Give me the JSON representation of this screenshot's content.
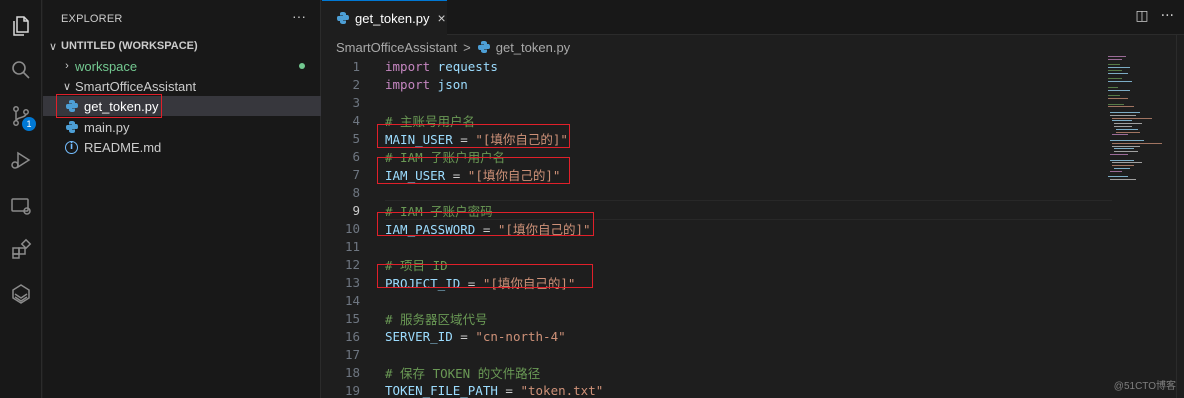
{
  "sidebar": {
    "title": "EXPLORER",
    "more": "···",
    "workspace_title": "UNTITLED (WORKSPACE)",
    "items": [
      {
        "label": "workspace"
      },
      {
        "label": "SmartOfficeAssistant"
      },
      {
        "label": "get_token.py"
      },
      {
        "label": "main.py"
      },
      {
        "label": "README.md"
      }
    ]
  },
  "activity": {
    "source_control_badge": "1"
  },
  "tab": {
    "label": "get_token.py",
    "close": "×"
  },
  "tab_actions": {
    "split": "◫",
    "more": "···"
  },
  "breadcrumb": {
    "folder": "SmartOfficeAssistant",
    "sep": ">",
    "file": "get_token.py"
  },
  "code": {
    "active_line": 9,
    "lines": [
      {
        "n": "1",
        "parts": [
          {
            "t": "import",
            "c": "kw"
          },
          {
            "t": " requests",
            "c": "plain"
          }
        ]
      },
      {
        "n": "2",
        "parts": [
          {
            "t": "import",
            "c": "kw"
          },
          {
            "t": " json",
            "c": "plain"
          }
        ]
      },
      {
        "n": "3",
        "parts": []
      },
      {
        "n": "4",
        "parts": [
          {
            "t": "# 主账号用户名",
            "c": "cmt"
          }
        ]
      },
      {
        "n": "5",
        "parts": [
          {
            "t": "MAIN_USER",
            "c": "plain"
          },
          {
            "t": " = ",
            "c": "plain"
          },
          {
            "t": "\"[填你自己的]\"",
            "c": "str"
          }
        ]
      },
      {
        "n": "6",
        "parts": [
          {
            "t": "# IAM 子账户用户名",
            "c": "cmt"
          }
        ]
      },
      {
        "n": "7",
        "parts": [
          {
            "t": "IAM_USER",
            "c": "plain"
          },
          {
            "t": " = ",
            "c": "plain"
          },
          {
            "t": "\"[填你自己的]\"",
            "c": "str"
          }
        ]
      },
      {
        "n": "8",
        "parts": []
      },
      {
        "n": "9",
        "parts": [
          {
            "t": "# IAM 子账户密码",
            "c": "cmt"
          }
        ]
      },
      {
        "n": "10",
        "parts": [
          {
            "t": "IAM_PASSWORD",
            "c": "plain"
          },
          {
            "t": " = ",
            "c": "plain"
          },
          {
            "t": "\"[填你自己的]\"",
            "c": "str"
          }
        ]
      },
      {
        "n": "11",
        "parts": []
      },
      {
        "n": "12",
        "parts": [
          {
            "t": "# 项目 ID",
            "c": "cmt"
          }
        ]
      },
      {
        "n": "13",
        "parts": [
          {
            "t": "PROJECT_ID",
            "c": "plain"
          },
          {
            "t": " = ",
            "c": "plain"
          },
          {
            "t": "\"[填你自己的]\"",
            "c": "str"
          }
        ]
      },
      {
        "n": "14",
        "parts": []
      },
      {
        "n": "15",
        "parts": [
          {
            "t": "# 服务器区域代号",
            "c": "cmt"
          }
        ]
      },
      {
        "n": "16",
        "parts": [
          {
            "t": "SERVER_ID",
            "c": "plain"
          },
          {
            "t": " = ",
            "c": "plain"
          },
          {
            "t": "\"cn-north-4\"",
            "c": "str"
          }
        ]
      },
      {
        "n": "17",
        "parts": []
      },
      {
        "n": "18",
        "parts": [
          {
            "t": "# 保存 TOKEN 的文件路径",
            "c": "cmt"
          }
        ]
      },
      {
        "n": "19",
        "parts": [
          {
            "t": "TOKEN_FILE_PATH",
            "c": "plain"
          },
          {
            "t": " = ",
            "c": "plain"
          },
          {
            "t": "\"token.txt\"",
            "c": "str"
          }
        ]
      }
    ]
  },
  "watermark": "@51CTO博客",
  "colors": {
    "accent": "#0078d4",
    "highlight": "#e0202a",
    "git_added": "#73c991"
  }
}
